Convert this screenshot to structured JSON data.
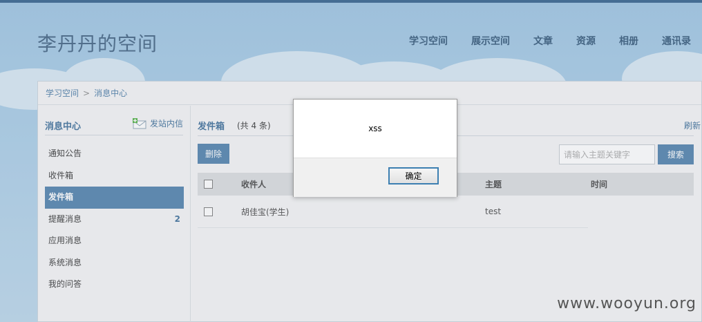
{
  "site": {
    "title": "李丹丹的空间"
  },
  "nav": {
    "items": [
      {
        "label": "学习空间"
      },
      {
        "label": "展示空间"
      },
      {
        "label": "文章"
      },
      {
        "label": "资源"
      },
      {
        "label": "相册"
      },
      {
        "label": "通讯录"
      }
    ]
  },
  "breadcrumb": {
    "root": "学习空间",
    "separator": ">",
    "current": "消息中心"
  },
  "sidebar": {
    "title": "消息中心",
    "compose_label": "发站内信",
    "items": [
      {
        "label": "通知公告",
        "count": ""
      },
      {
        "label": "收件箱",
        "count": ""
      },
      {
        "label": "发件箱",
        "count": ""
      },
      {
        "label": "提醒消息",
        "count": "2"
      },
      {
        "label": "应用消息",
        "count": ""
      },
      {
        "label": "系统消息",
        "count": ""
      },
      {
        "label": "我的问答",
        "count": ""
      }
    ],
    "active_index": 2
  },
  "main": {
    "title": "发件箱",
    "count_text": "(共 4 条)",
    "refresh_label": "刷新",
    "delete_label": "删除",
    "search_placeholder": "请输入主题关键字",
    "search_label": "搜索",
    "columns": {
      "recipient": "收件人",
      "subject": "主题",
      "time": "时间"
    },
    "rows": [
      {
        "recipient": "胡佳宝(学生)",
        "subject": "test",
        "time": ""
      }
    ]
  },
  "dialog": {
    "message": "xss",
    "ok_label": "确定"
  },
  "watermark": "www.wooyun.org",
  "colors": {
    "accent": "#4e7fab",
    "nav_text": "#2f5577",
    "sky": "#a9cde7"
  }
}
